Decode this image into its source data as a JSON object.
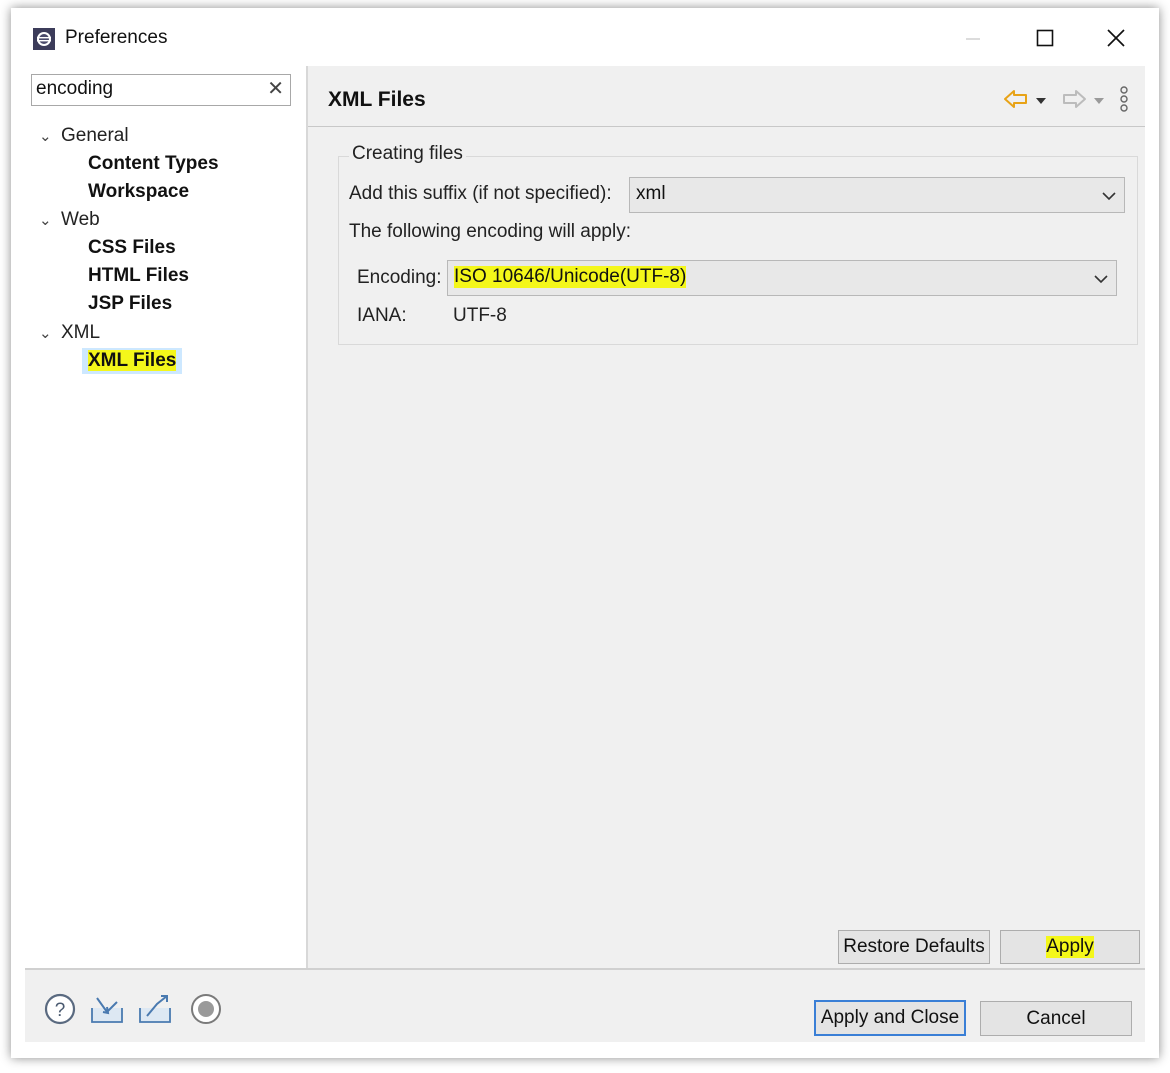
{
  "window": {
    "title": "Preferences",
    "controls": [
      "minimize-icon",
      "maximize-icon",
      "close-icon"
    ]
  },
  "filter": {
    "value": "encoding",
    "clear_icon": "clear-x-icon"
  },
  "tree": {
    "categories": [
      {
        "label": "General",
        "children": [
          "Content Types",
          "Workspace"
        ]
      },
      {
        "label": "Web",
        "children": [
          "CSS Files",
          "HTML Files",
          "JSP Files"
        ]
      },
      {
        "label": "XML",
        "children": [
          "XML Files"
        ]
      }
    ],
    "selected": "XML Files"
  },
  "page": {
    "title": "XML Files",
    "nav_icons": [
      "back-arrow-icon",
      "back-dropdown-icon",
      "forward-arrow-icon",
      "forward-dropdown-icon",
      "view-menu-icon"
    ],
    "group_label": "Creating files",
    "suffix_label": "Add this suffix (if not specified):",
    "suffix_value": "xml",
    "encoding_note": "The following encoding will apply:",
    "encoding_label": "Encoding:",
    "encoding_value": "ISO 10646/Unicode(UTF-8)",
    "iana_label": "IANA:",
    "iana_value": "UTF-8",
    "restore_defaults": "Restore Defaults",
    "apply": "Apply"
  },
  "footer": {
    "icons": [
      "help-icon",
      "import-icon",
      "export-icon",
      "record-icon"
    ],
    "apply_and_close": "Apply and Close",
    "cancel": "Cancel"
  },
  "colors": {
    "highlight": "#f4f71a",
    "selection": "#cde8ff",
    "default_button_border": "#3a7fd6",
    "nav_back_arrow": "#e8a317"
  }
}
